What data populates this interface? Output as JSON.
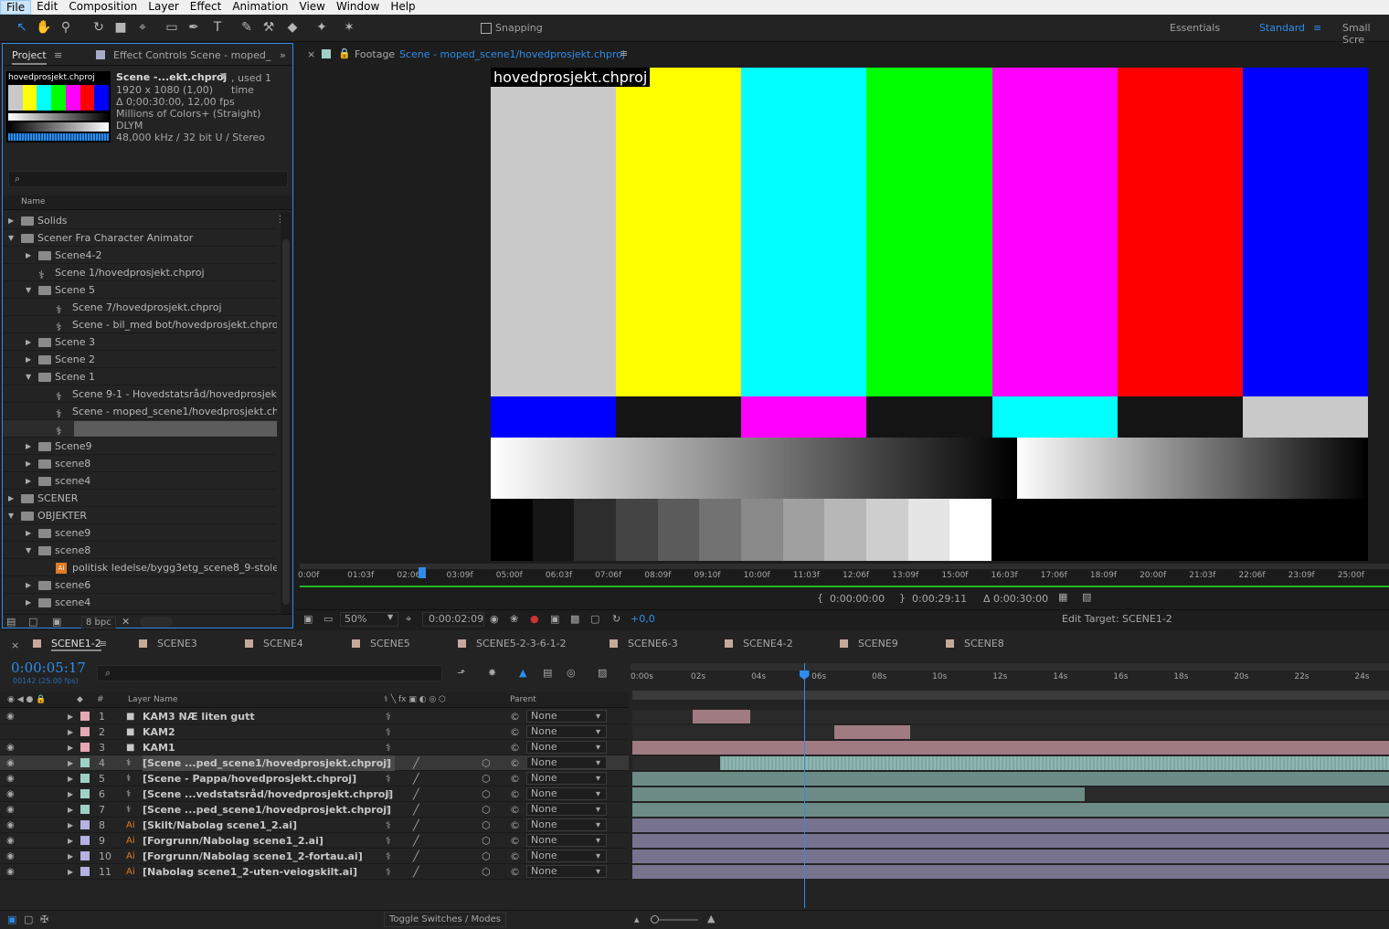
{
  "menu": [
    "File",
    "Edit",
    "Composition",
    "Layer",
    "Effect",
    "Animation",
    "View",
    "Window",
    "Help"
  ],
  "toolbar": {
    "snapping_label": "Snapping",
    "workspaces": [
      "Essentials",
      "Standard",
      "Small Scre"
    ]
  },
  "project": {
    "tab_project": "Project",
    "tab_effect": "Effect Controls Scene - moped_",
    "thumb_label": "hovedprosjekt.chproj",
    "info": {
      "name": "Scene -...ekt.chproj",
      "used": ", used 1 time",
      "size": "1920 x 1080 (1,00)",
      "duration": "Δ 0;00:30:00, 12,00 fps",
      "colors": "Millions of Colors+ (Straight)",
      "codec": "DLYM",
      "audio": "48,000 kHz / 32 bit U / Stereo"
    },
    "search_placeholder": "",
    "col_name": "Name",
    "bpc": "8 bpc",
    "tree": [
      {
        "label": "Solids",
        "indent": 0,
        "kind": "folder",
        "tw": "▶"
      },
      {
        "label": "Scener Fra Character Animator",
        "indent": 0,
        "kind": "folder",
        "tw": "▼"
      },
      {
        "label": "Scene4-2",
        "indent": 1,
        "kind": "folder",
        "tw": "▶"
      },
      {
        "label": "Scene 1/hovedprosjekt.chproj",
        "indent": 1,
        "kind": "comp",
        "tw": ""
      },
      {
        "label": "Scene 5",
        "indent": 1,
        "kind": "folder",
        "tw": "▼"
      },
      {
        "label": "Scene 7/hovedprosjekt.chproj",
        "indent": 2,
        "kind": "comp",
        "tw": ""
      },
      {
        "label": "Scene - bil_med bot/hovedprosjekt.chproj",
        "indent": 2,
        "kind": "comp",
        "tw": ""
      },
      {
        "label": "Scene 3",
        "indent": 1,
        "kind": "folder",
        "tw": "▶"
      },
      {
        "label": "Scene 2",
        "indent": 1,
        "kind": "folder",
        "tw": "▶"
      },
      {
        "label": "Scene 1",
        "indent": 1,
        "kind": "folder",
        "tw": "▼"
      },
      {
        "label": "Scene 9-1 - Hovedstatsråd/hovedprosjekt.ch",
        "indent": 2,
        "kind": "comp",
        "tw": ""
      },
      {
        "label": "Scene - moped_scene1/hovedprosjekt.chproj",
        "indent": 2,
        "kind": "comp",
        "tw": ""
      },
      {
        "label": "",
        "indent": 2,
        "kind": "comp-edit",
        "tw": ""
      },
      {
        "label": "Scene9",
        "indent": 1,
        "kind": "folder",
        "tw": "▶"
      },
      {
        "label": "scene8",
        "indent": 1,
        "kind": "folder",
        "tw": "▶"
      },
      {
        "label": "scene4",
        "indent": 1,
        "kind": "folder",
        "tw": "▶"
      },
      {
        "label": "SCENER",
        "indent": 0,
        "kind": "folder",
        "tw": "▶"
      },
      {
        "label": "OBJEKTER",
        "indent": 0,
        "kind": "folder",
        "tw": "▼"
      },
      {
        "label": "scene9",
        "indent": 1,
        "kind": "folder",
        "tw": "▶"
      },
      {
        "label": "scene8",
        "indent": 1,
        "kind": "folder",
        "tw": "▼"
      },
      {
        "label": "politisk ledelse/bygg3etg_scene8_9-stoler.a",
        "indent": 2,
        "kind": "ai",
        "tw": ""
      },
      {
        "label": "scene6",
        "indent": 1,
        "kind": "folder",
        "tw": "▶"
      },
      {
        "label": "scene4",
        "indent": 1,
        "kind": "folder",
        "tw": "▶"
      }
    ]
  },
  "viewer": {
    "tab_label": "Footage",
    "tab_path": "Scene - moped_scene1/hovedprosjekt.chproj",
    "overlay_label": "hovedprosjekt.chproj",
    "ruler_ticks": [
      "0:00f",
      "01:03f",
      "02:06f",
      "03:09f",
      "05:00f",
      "06:03f",
      "07:06f",
      "08:09f",
      "09:10f",
      "10:00f",
      "11:03f",
      "12:06f",
      "13:09f",
      "15:00f",
      "16:03f",
      "17:06f",
      "18:09f",
      "20:00f",
      "21:03f",
      "22:06f",
      "23:09f",
      "25:00f"
    ],
    "in_time": "0:00:00:00",
    "out_time": "0:00:29:11",
    "duration": "Δ 0:00:30:00",
    "zoom": "50%",
    "current_time": "0:00:02:09",
    "exposure": "+0,0",
    "edit_target": "Edit Target: SCENE1-2",
    "bars_top": [
      "#c9c9c9",
      "#ffff00",
      "#00ffff",
      "#00ff00",
      "#ff00ff",
      "#ff0000",
      "#0000ff"
    ],
    "bars_mid": [
      "#0000ff",
      "#141414",
      "#ff00ff",
      "#141414",
      "#00ffff",
      "#141414",
      "#c9c9c9"
    ],
    "steps": [
      "#000000",
      "#161616",
      "#2d2d2d",
      "#444444",
      "#5b5b5b",
      "#727272",
      "#898989",
      "#a0a0a0",
      "#b7b7b7",
      "#cecece",
      "#e5e5e5",
      "#ffffff"
    ]
  },
  "timeline": {
    "tabs": [
      {
        "label": "SCENE1-2",
        "color": "#c7a99c"
      },
      {
        "label": "SCENE3",
        "color": "#c7a99c"
      },
      {
        "label": "SCENE4",
        "color": "#c7a99c"
      },
      {
        "label": "SCENE5",
        "color": "#c7a99c"
      },
      {
        "label": "SCENE5-2-3-6-1-2",
        "color": "#c7a99c"
      },
      {
        "label": "SCENE6-3",
        "color": "#c7a99c"
      },
      {
        "label": "SCENE4-2",
        "color": "#c7a99c"
      },
      {
        "label": "SCENE9",
        "color": "#c7a99c"
      },
      {
        "label": "SCENE8",
        "color": "#c7a99c"
      }
    ],
    "timecode": "0:00:05:17",
    "frame_info": "00142 (25.00 fps)",
    "col_layer_name": "Layer Name",
    "col_parent": "Parent",
    "ruler": [
      "0:00s",
      "02s",
      "04s",
      "06s",
      "08s",
      "10s",
      "12s",
      "14s",
      "16s",
      "18s",
      "20s",
      "22s",
      "24s"
    ],
    "toggle_label": "Toggle Switches / Modes",
    "layers": [
      {
        "num": "1",
        "name": "KAM3 NÆ liten gutt",
        "label_color": "#e6a8b4",
        "kind": "camera",
        "parent": "None",
        "bar_color": "#a07b82",
        "bar_start": 0.0,
        "bar_end": 0.0,
        "solo": true,
        "eye": true,
        "seg": [
          2.0,
          3.9
        ]
      },
      {
        "num": "2",
        "name": "KAM2",
        "label_color": "#e6a8b4",
        "kind": "camera",
        "parent": "None",
        "bar_color": "#a07b82",
        "eye": false,
        "seg": [
          6.7,
          9.2
        ]
      },
      {
        "num": "3",
        "name": "KAM1",
        "label_color": "#e6a8b4",
        "kind": "camera",
        "parent": "None",
        "bar_color": "#a07b82",
        "eye": true,
        "seg": [
          0,
          25.5
        ]
      },
      {
        "num": "4",
        "name": "[Scene ...ped_scene1/hovedprosjekt.chproj]",
        "label_color": "#9fd0c6",
        "kind": "comp",
        "parent": "None",
        "bar_color": "#7fa6a0",
        "eye": true,
        "selected": true,
        "seg": [
          2.9,
          25.5
        ]
      },
      {
        "num": "5",
        "name": "[Scene - Pappa/hovedprosjekt.chproj]",
        "label_color": "#9fd0c6",
        "kind": "comp",
        "parent": "None",
        "bar_color": "#6d8c87",
        "eye": true,
        "seg": [
          0,
          25.5
        ]
      },
      {
        "num": "6",
        "name": "[Scene ...vedstatsråd/hovedprosjekt.chproj]",
        "label_color": "#9fd0c6",
        "kind": "comp",
        "parent": "None",
        "bar_color": "#6d8c87",
        "eye": true,
        "seg": [
          0,
          15.0
        ]
      },
      {
        "num": "7",
        "name": "[Scene ...ped_scene1/hovedprosjekt.chproj]",
        "label_color": "#9fd0c6",
        "kind": "comp",
        "parent": "None",
        "bar_color": "#6d8c87",
        "eye": true,
        "seg": [
          0,
          25.5
        ]
      },
      {
        "num": "8",
        "name": "[Skilt/Nabolag scene1_2.ai]",
        "label_color": "#b5b1e0",
        "kind": "ai",
        "parent": "None",
        "bar_color": "#77738f",
        "eye": true,
        "seg": [
          0,
          25.5
        ]
      },
      {
        "num": "9",
        "name": "[Forgrunn/Nabolag scene1_2.ai]",
        "label_color": "#b5b1e0",
        "kind": "ai",
        "parent": "None",
        "bar_color": "#77738f",
        "eye": true,
        "seg": [
          0,
          25.5
        ]
      },
      {
        "num": "10",
        "name": "[Forgrunn/Nabolag scene1_2-fortau.ai]",
        "label_color": "#b5b1e0",
        "kind": "ai",
        "parent": "None",
        "bar_color": "#77738f",
        "eye": true,
        "seg": [
          0,
          25.5
        ]
      },
      {
        "num": "11",
        "name": "[Nabolag scene1_2-uten-veiogskilt.ai]",
        "label_color": "#b5b1e0",
        "kind": "ai",
        "parent": "None",
        "bar_color": "#77738f",
        "eye": true,
        "seg": [
          0,
          25.5
        ]
      }
    ],
    "playhead_seconds": 5.68
  }
}
